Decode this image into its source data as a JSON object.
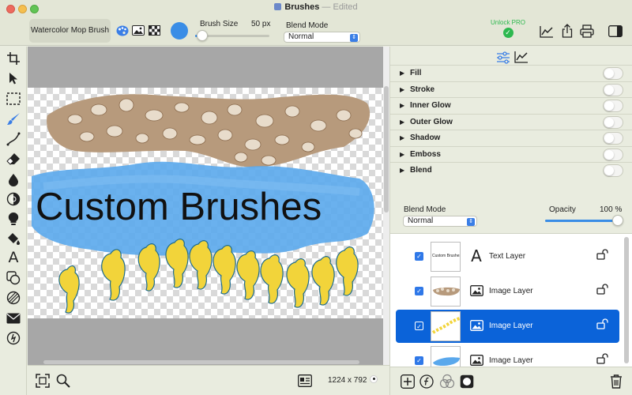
{
  "window": {
    "app_icon": "brushes-doc-icon",
    "title": "Brushes",
    "edited": "— Edited"
  },
  "toolbar": {
    "brush_name": "Watercolor Mop Brush",
    "icons": [
      "palette-icon",
      "image-icon",
      "checkerboard-icon"
    ],
    "color": "#3a8de6",
    "brush_size_label": "Brush Size",
    "brush_size_value": "50 px",
    "brush_size_level": 0.1,
    "blend_mode_label": "Blend Mode",
    "blend_mode_value": "Normal",
    "unlock_label": "Unlock PRO",
    "right_icons": [
      "chart-icon",
      "share-icon",
      "print-icon",
      "sidebar-icon"
    ]
  },
  "tools": [
    "crop-icon",
    "pointer-icon",
    "marquee-icon",
    "brush-icon",
    "pen-icon",
    "eraser-icon",
    "drop-icon",
    "blur-icon",
    "bulb-icon",
    "bucket-icon",
    "text-icon",
    "shapes-icon",
    "gradient-icon",
    "mail-icon",
    "add-circle-icon"
  ],
  "canvas": {
    "text": "Custom Brushes",
    "size": "1224 x 792",
    "colors": {
      "brush": "#5aa8ec",
      "seahorse": "#f2d43a",
      "text": "#111111"
    }
  },
  "effects": {
    "tabs": [
      "sliders-icon",
      "chart-icon"
    ],
    "items": [
      {
        "label": "Fill",
        "on": false
      },
      {
        "label": "Stroke",
        "on": false
      },
      {
        "label": "Inner Glow",
        "on": false
      },
      {
        "label": "Outer Glow",
        "on": false
      },
      {
        "label": "Shadow",
        "on": false
      },
      {
        "label": "Emboss",
        "on": false
      },
      {
        "label": "Blend",
        "on": false
      }
    ]
  },
  "layer_props": {
    "blend_mode_label": "Blend Mode",
    "blend_mode_value": "Normal",
    "opacity_label": "Opacity",
    "opacity_value": "100 %",
    "opacity_level": 1.0
  },
  "layers": [
    {
      "name": "Text Layer",
      "type": "text",
      "thumb_text": "Custom Brushes",
      "visible": true,
      "selected": false
    },
    {
      "name": "Image Layer",
      "type": "image",
      "thumb": "shells",
      "visible": true,
      "selected": false
    },
    {
      "name": "Image Layer",
      "type": "image",
      "thumb": "seahorses",
      "visible": true,
      "selected": true
    },
    {
      "name": "Image Layer",
      "type": "image",
      "thumb": "watercolor",
      "visible": true,
      "selected": false
    }
  ],
  "layer_actions": [
    "add-icon",
    "function-icon",
    "blend-circles-icon",
    "mask-icon",
    "trash-icon"
  ],
  "canvas_actions": [
    "fit-icon",
    "zoom-icon",
    "document-info-icon"
  ]
}
